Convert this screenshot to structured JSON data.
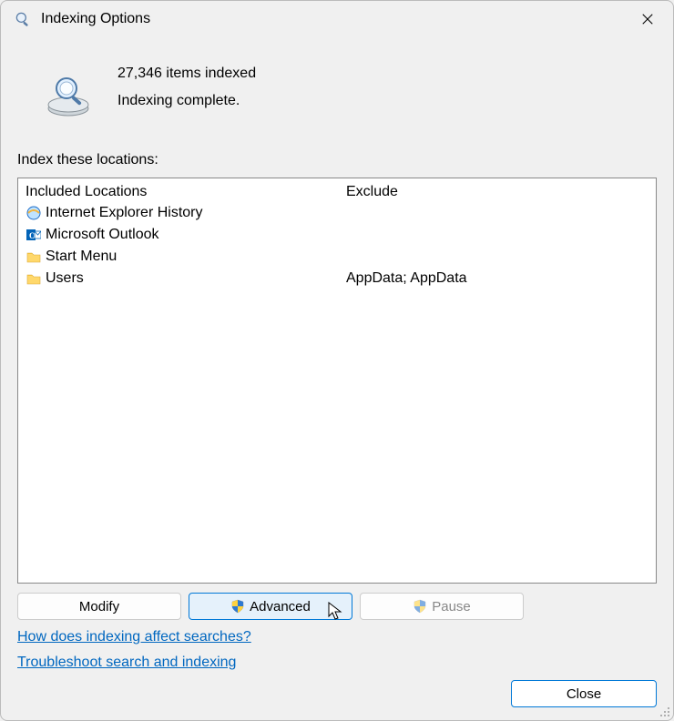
{
  "title": "Indexing Options",
  "status": {
    "line1": "27,346 items indexed",
    "line2": "Indexing complete."
  },
  "locations_label": "Index these locations:",
  "columns": {
    "included": "Included Locations",
    "exclude": "Exclude"
  },
  "locations": [
    {
      "label": "Internet Explorer History",
      "icon": "ie-icon",
      "exclude": ""
    },
    {
      "label": "Microsoft Outlook",
      "icon": "outlook-icon",
      "exclude": ""
    },
    {
      "label": "Start Menu",
      "icon": "folder-icon",
      "exclude": ""
    },
    {
      "label": "Users",
      "icon": "folder-icon",
      "exclude": "AppData; AppData"
    }
  ],
  "buttons": {
    "modify": "Modify",
    "advanced": "Advanced",
    "pause": "Pause",
    "close": "Close"
  },
  "links": {
    "affect": "How does indexing affect searches?",
    "troubleshoot": "Troubleshoot search and indexing"
  }
}
